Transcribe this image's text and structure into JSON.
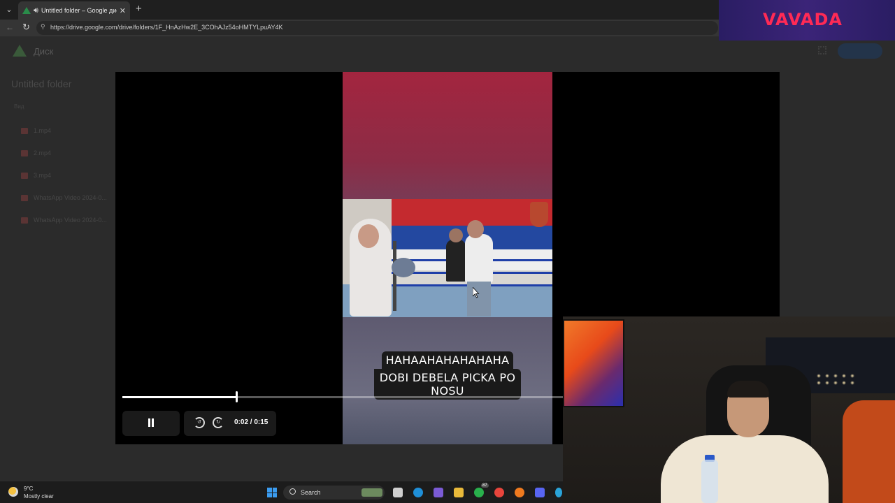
{
  "browser": {
    "tab_title": "Untitled folder – Google диск",
    "url": "https://drive.google.com/drive/folders/1F_HnAzHw2E_3COhAJz54oHMTYLpuAY4K"
  },
  "drive": {
    "brand": "Диск",
    "folder_title": "Untitled folder",
    "filter_label": "Вид",
    "files": [
      "1.mp4",
      "2.mp4",
      "3.mp4",
      "WhatsApp Video 2024-0...",
      "WhatsApp Video 2024-0..."
    ]
  },
  "video": {
    "caption_line1": "HAHAAHAHAHAHAHA",
    "caption_line2": "DOBI DEBELA PICKA PO NOSU",
    "time": "0:02 / 0:15",
    "progress": 0.173
  },
  "ad": {
    "brand": "VAVADA"
  },
  "taskbar": {
    "temperature": "9°C",
    "weather": "Mostly clear",
    "search_label": "Search",
    "notification_count": "87"
  },
  "colors": {
    "accent_pink": "#ff2a55",
    "ad_bg": "#2a1d63",
    "video_top": "#a3253f"
  }
}
